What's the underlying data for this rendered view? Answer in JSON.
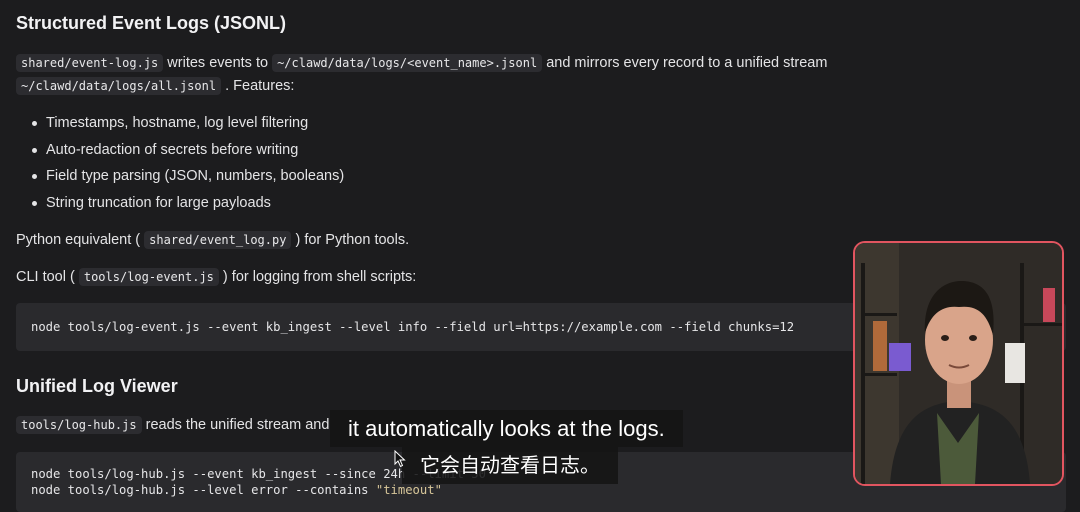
{
  "section1": {
    "heading": "Structured Event Logs (JSONL)",
    "intro": {
      "code1": "shared/event-log.js",
      "text1": " writes events to ",
      "code2": "~/clawd/data/logs/<event_name>.jsonl",
      "text2": " and mirrors every record to a unified stream",
      "code3": "~/clawd/data/logs/all.jsonl",
      "text3": " . Features:"
    },
    "features": [
      "Timestamps, hostname, log level filtering",
      "Auto-redaction of secrets before writing",
      "Field type parsing (JSON, numbers, booleans)",
      "String truncation for large payloads"
    ],
    "python": {
      "text1": "Python equivalent ( ",
      "code": "shared/event_log.py",
      "text2": " ) for Python tools."
    },
    "cli": {
      "text1": "CLI tool ( ",
      "code": "tools/log-event.js",
      "text2": " ) for logging from shell scripts:"
    },
    "code_block": "node tools/log-event.js --event kb_ingest --level info --field url=https://example.com --field chunks=12"
  },
  "section2": {
    "heading": "Unified Log Viewer",
    "intro": {
      "code": "tools/log-hub.js",
      "text": " reads the unified stream and"
    },
    "code_line1": "node tools/log-hub.js --event kb_ingest --since 24h --limit 50",
    "code_line2_a": "node tools/log-hub.js --level error --contains ",
    "code_line2_b": "\"timeout\""
  },
  "captions": {
    "english": "it automatically looks at the logs.",
    "chinese": "它会自动查看日志。"
  },
  "colors": {
    "page_bg": "#1c1c1e",
    "code_bg": "#2a2a2d",
    "pip_border": "#e25560",
    "string": "#d8c79a"
  },
  "icons": {
    "cursor": "mouse-pointer-icon"
  }
}
